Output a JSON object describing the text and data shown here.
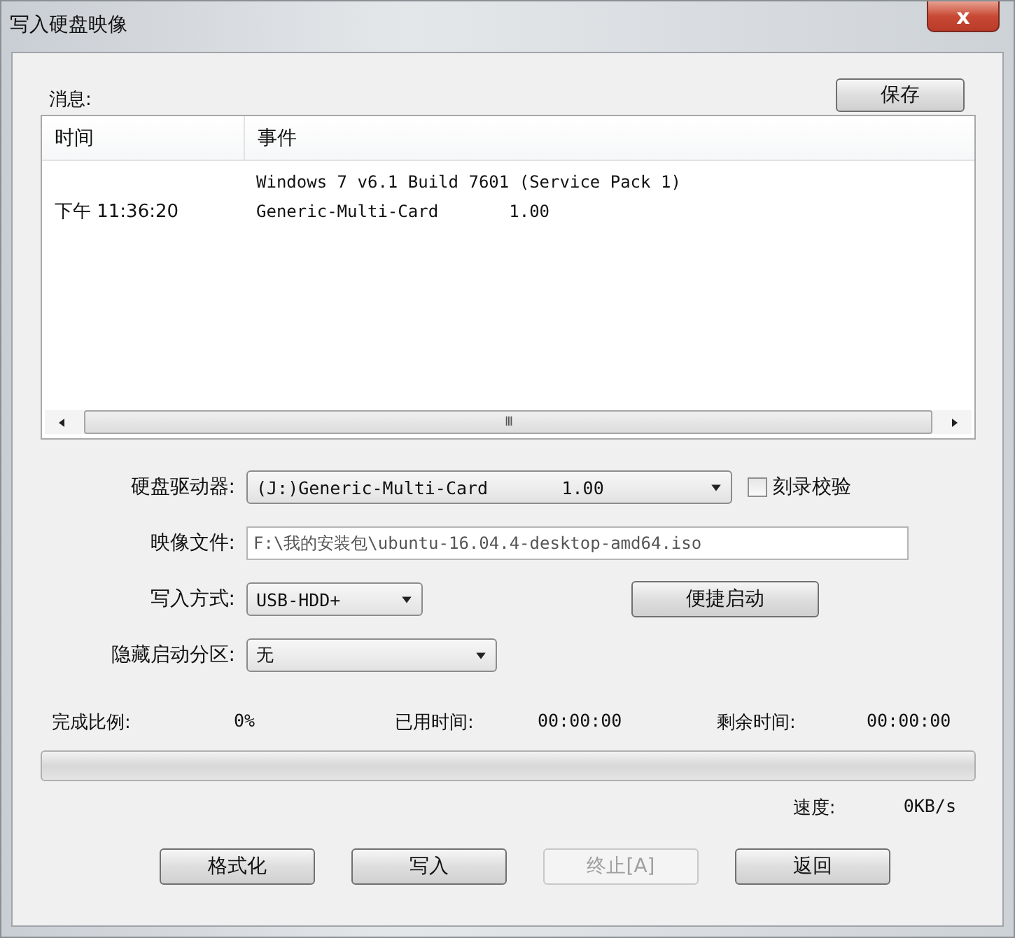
{
  "window": {
    "title": "写入硬盘映像",
    "close": "x"
  },
  "messages": {
    "label": "消息:",
    "save_button": "保存",
    "columns": [
      "时间",
      "事件"
    ],
    "rows": [
      {
        "time": "",
        "event": "Windows 7 v6.1 Build 7601 (Service Pack 1)"
      },
      {
        "time": "下午 11:36:20",
        "event": "Generic-Multi-Card       1.00"
      }
    ],
    "scroll_grip": "III"
  },
  "form": {
    "drive": {
      "label": "硬盘驱动器:",
      "value": "(J:)Generic-Multi-Card       1.00"
    },
    "verify": {
      "label": "刻录校验",
      "checked": false
    },
    "image_file": {
      "label": "映像文件:",
      "value": "F:\\我的安装包\\ubuntu-16.04.4-desktop-amd64.iso"
    },
    "write_method": {
      "label": "写入方式:",
      "value": "USB-HDD+"
    },
    "quick_boot_button": "便捷启动",
    "hidden_partition": {
      "label": "隐藏启动分区:",
      "value": "无"
    }
  },
  "progress": {
    "stats": [
      {
        "label": "完成比例:",
        "value": "0%"
      },
      {
        "label": "已用时间:",
        "value": "00:00:00"
      },
      {
        "label": "剩余时间:",
        "value": "00:00:00"
      }
    ],
    "level": 0,
    "speed_label": "速度:",
    "speed": "0KB/s"
  },
  "buttons": [
    {
      "label": "格式化",
      "disabled": false
    },
    {
      "label": "写入",
      "disabled": false
    },
    {
      "label": "终止[A]",
      "disabled": true
    },
    {
      "label": "返回",
      "disabled": false
    }
  ]
}
